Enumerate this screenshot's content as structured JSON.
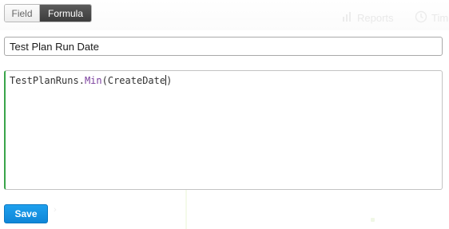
{
  "mode_toggle": {
    "field_label": "Field",
    "formula_label": "Formula",
    "selected": "Formula"
  },
  "background_nav": {
    "reports_label": "Reports",
    "reports_icon": "bar-chart-icon",
    "time_label": "Tim",
    "time_icon": "clock-icon"
  },
  "name_field": {
    "value": "Test Plan Run Date"
  },
  "formula_editor": {
    "object": "TestPlanRuns",
    "separator": ".",
    "method": "Min",
    "open_paren": "(",
    "argument": "CreateDate",
    "close_paren": ")",
    "accent_color": "#3aa44a",
    "method_color": "#7a3e9d"
  },
  "actions": {
    "save_label": "Save",
    "save_color": "#1a95e6"
  }
}
